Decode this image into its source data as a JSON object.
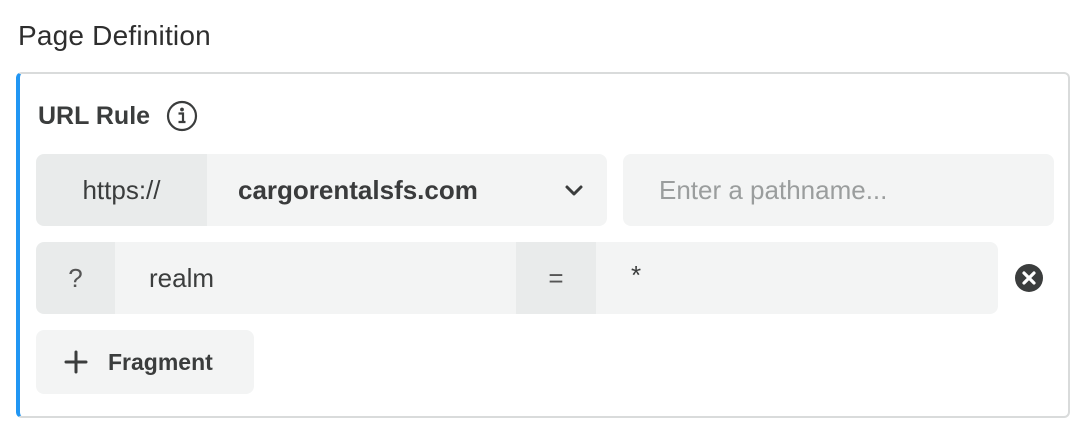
{
  "section": {
    "title": "Page Definition"
  },
  "url_rule": {
    "title": "URL Rule",
    "protocol": "https://",
    "domain": "cargorentalsfs.com",
    "pathname_placeholder": "Enter a pathname...",
    "pathname_value": ""
  },
  "query_param": {
    "prefix": "?",
    "key": "realm",
    "operator": "=",
    "value": "*"
  },
  "fragment_button": {
    "label": "Fragment"
  },
  "colors": {
    "accent": "#2196f3",
    "panel_border": "#d9dbdb",
    "field_bg": "#f3f4f4",
    "field_dark_bg": "#e9ebeb",
    "text": "#3b3d3d"
  },
  "icons": {
    "info": "info-icon",
    "chevron": "chevron-down-icon",
    "remove": "close-circle-icon",
    "add": "plus-icon"
  }
}
